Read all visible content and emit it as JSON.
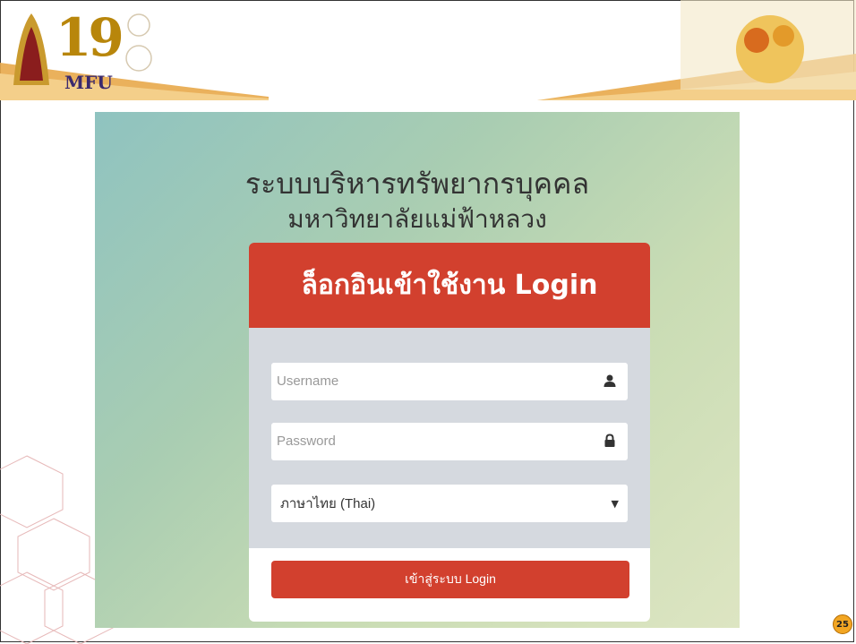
{
  "slide": {
    "logo_number": "19",
    "logo_text": "MFU",
    "page_number": "25"
  },
  "login": {
    "title_line1": "ระบบบริหารทรัพยากรบุคคล",
    "title_line2": "มหาวิทยาลัยแม่ฟ้าหลวง",
    "panel_title": "ล็อกอินเข้าใช้งาน Login",
    "username_placeholder": "Username",
    "password_placeholder": "Password",
    "language_selected": "ภาษาไทย (Thai)",
    "submit_label": "เข้าสู่ระบบ Login"
  },
  "colors": {
    "accent_red": "#d2402e",
    "panel_gray": "#d5d9df",
    "badge_orange": "#f2a623"
  }
}
